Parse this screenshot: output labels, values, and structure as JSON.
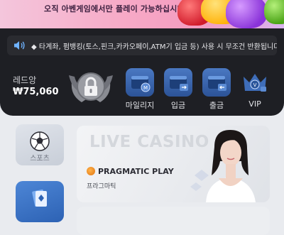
{
  "banner": {
    "text": "오직 아벤게임에서만 플레이 가능하십시다."
  },
  "notice": {
    "icon": "speaker-icon",
    "text": "◆ 타계좌, 펌뱅킹(토스,핀크,카카오페이,ATM기 입금 등) 사용 시 무조건 반환됩니다."
  },
  "user": {
    "name": "레드앙",
    "balance": "₩75,060"
  },
  "actions": [
    {
      "label": "마일리지",
      "icon": "wallet-mileage-icon"
    },
    {
      "label": "입금",
      "icon": "wallet-deposit-icon"
    },
    {
      "label": "출금",
      "icon": "wallet-withdraw-icon"
    },
    {
      "label": "VIP",
      "icon": "crown-icon"
    }
  ],
  "categories": [
    {
      "label": "스포츠",
      "icon": "soccer-ball-icon"
    },
    {
      "label": "",
      "icon": "cards-icon"
    }
  ],
  "game_card": {
    "title": "LIVE CASINO",
    "provider": "PRAGMATIC PLAY",
    "provider_sub": "프라그마틱"
  },
  "colors": {
    "panel_bg": "#1e1f24",
    "accent_blue": "#3a68b3",
    "page_bg": "#e9ebef"
  }
}
